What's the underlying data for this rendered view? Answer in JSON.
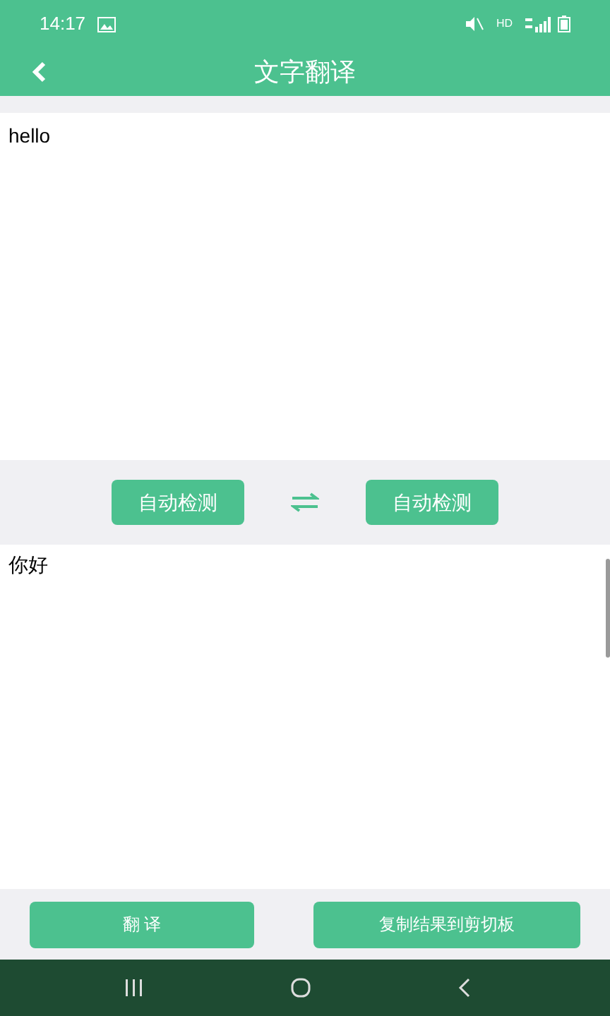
{
  "status_bar": {
    "time": "14:17",
    "network": "HD"
  },
  "header": {
    "title": "文字翻译"
  },
  "source": {
    "value": "hello"
  },
  "languages": [
    {
      "label": "自动检测"
    },
    {
      "label": "自动检测"
    }
  ],
  "result": {
    "value": "你好"
  },
  "actions": [
    {
      "label": "翻 译"
    },
    {
      "label": "复制结果到剪切板"
    }
  ]
}
